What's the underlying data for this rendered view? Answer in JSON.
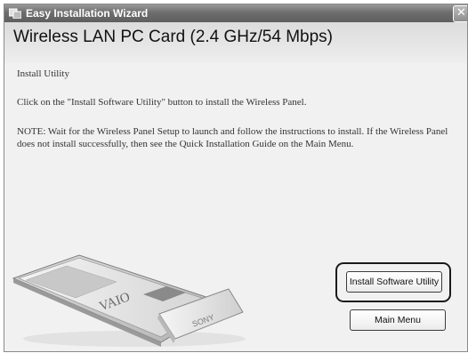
{
  "window": {
    "title": "Easy Installation Wizard",
    "close_glyph": "✕",
    "icon": "installer-app-icon"
  },
  "header": {
    "title": "Wireless LAN PC Card (2.4 GHz/54 Mbps)"
  },
  "content": {
    "section_label": "Install Utility",
    "instruction": "Click on the \"Install Software Utility\" button to install the Wireless Panel.",
    "note": "NOTE: Wait for the Wireless Panel Setup to launch and follow the instructions to install. If the Wireless Panel does not install successfully, then see the Quick Installation Guide on the Main Menu."
  },
  "illustration": {
    "subject": "pc-card",
    "logo_text": "VAIO",
    "brand_text": "SONY"
  },
  "buttons": {
    "install_software_utility": "Install Software Utility",
    "main_menu": "Main Menu"
  },
  "colors": {
    "titlebar": "#6e6e6e",
    "header_band": "#dcdcdc",
    "background": "#f1f1f1"
  }
}
